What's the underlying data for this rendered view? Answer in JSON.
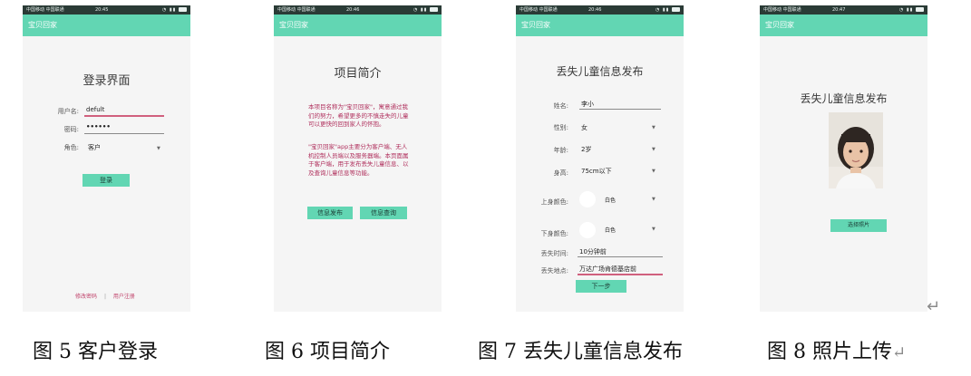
{
  "screens": [
    {
      "status": {
        "carrier": "中国移动 中国联通",
        "time": "20:45"
      },
      "appbar_title": "宝贝回家",
      "title": "登录界面",
      "username_label": "用户名:",
      "username_value": "defult",
      "password_label": "密码:",
      "password_value": "••••••",
      "role_label": "角色:",
      "role_value": "客户",
      "login_button": "登录",
      "link_change_password": "修改密码",
      "link_separator": "|",
      "link_register": "用户注册"
    },
    {
      "status": {
        "carrier": "中国移动 中国联通",
        "time": "20:46"
      },
      "appbar_title": "宝贝回家",
      "title": "项目简介",
      "paragraph1": "本项目名称为\"宝贝回家\"，寓意通过我们的努力，希望更多的不慎走失的儿童可以更快的回到家人的怀抱。",
      "paragraph2": "\"宝贝回家\"app主要分为客户端、无人机控制人员端以及服务器端。本页面属于客户端，用于发布丢失儿童信息、以及查询儿童信息等功能。",
      "btn_publish": "信息发布",
      "btn_query": "信息查询"
    },
    {
      "status": {
        "carrier": "中国移动 中国联通",
        "time": "20:46"
      },
      "appbar_title": "宝贝回家",
      "title": "丢失儿童信息发布",
      "name_label": "姓名:",
      "name_value": "李小",
      "gender_label": "性别:",
      "gender_value": "女",
      "age_label": "年龄:",
      "age_value": "2岁",
      "height_label": "身高:",
      "height_value": "75cm以下",
      "upper_color_label": "上身颜色:",
      "upper_color_value": "白色",
      "lower_color_label": "下身颜色:",
      "lower_color_value": "白色",
      "lost_time_label": "丢失时间:",
      "lost_time_value": "10分钟前",
      "lost_place_label": "丢失地点:",
      "lost_place_value": "万达广场肯德基店前",
      "next_button": "下一步"
    },
    {
      "status": {
        "carrier": "中国移动 中国联通",
        "time": "20:47"
      },
      "appbar_title": "宝贝回家",
      "title": "丢失儿童信息发布",
      "select_photo_button": "选择照片"
    }
  ],
  "captions": [
    "图 5 客户登录",
    "图 6 项目简介",
    "图 7 丢失儿童信息发布",
    "图 8 照片上传"
  ],
  "return_mark": "↵",
  "colors": {
    "appbar": "#62d6b3",
    "statusbar": "#2a3b36",
    "accent_text": "#b0305d",
    "underline": "#d0607e"
  }
}
